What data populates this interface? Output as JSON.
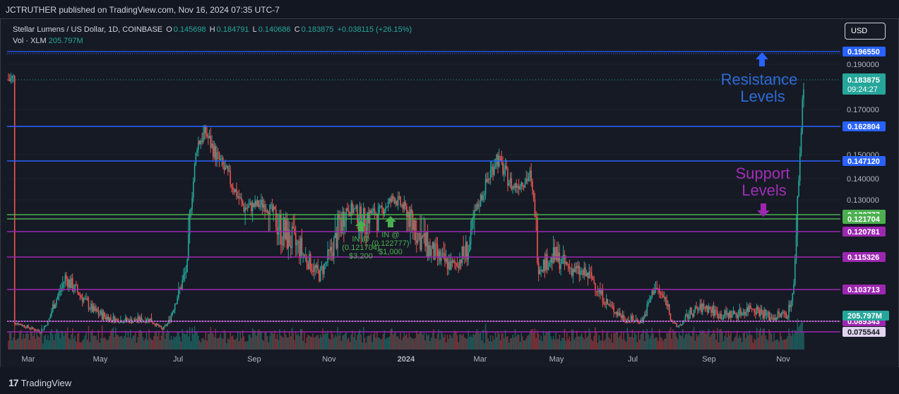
{
  "publisher_line": "JCTRUTHER published on TradingView.com, Nov 16, 2024 07:35 UTC-7",
  "header": {
    "instrument": "Stellar Lumens / US Dollar, 1D, COINBASE",
    "open_label": "O",
    "open": "0.145698",
    "high_label": "H",
    "high": "0.184791",
    "low_label": "L",
    "low": "0.140686",
    "close_label": "C",
    "close": "0.183875",
    "change": "+0.038115 (+26.15%)",
    "vol_label": "Vol · XLM",
    "vol_value": "205.797M"
  },
  "currency": "USD",
  "branding": "TradingView",
  "colors": {
    "bg": "#161a25",
    "up": "#26a69a",
    "down": "#ef5350",
    "resistance": "#2962ff",
    "support": "#9c27b0",
    "entry": "#4caf50",
    "axis_text": "#b2b5be",
    "resistance_text": "#2e6bd6",
    "support_text": "#a12eb5"
  },
  "chart_data": {
    "type": "candlestick",
    "y_ticks": [
      "0.190000",
      "0.170000",
      "0.150000",
      "0.140000",
      "0.130000"
    ],
    "x_ticks": [
      "Mar",
      "May",
      "Jul",
      "Sep",
      "Nov",
      "2024",
      "Mar",
      "May",
      "Jul",
      "Sep",
      "Nov"
    ],
    "price_labels": [
      {
        "text": "0.196550",
        "price": 0.19655,
        "color": "#2962ff"
      },
      {
        "text": "0.162804",
        "price": 0.162804,
        "color": "#2962ff"
      },
      {
        "text": "0.147120",
        "price": 0.14712,
        "color": "#2962ff"
      },
      {
        "text": "0.122777",
        "price": 0.122777,
        "color": "#4caf50"
      },
      {
        "text": "0.121704",
        "price": 0.121704,
        "color": "#4caf50"
      },
      {
        "text": "0.120781",
        "price": 0.120781,
        "color": "#9c27b0"
      },
      {
        "text": "0.115326",
        "price": 0.115326,
        "color": "#9c27b0"
      },
      {
        "text": "0.103713",
        "price": 0.103713,
        "color": "#9c27b0"
      },
      {
        "text": "0.089343",
        "price": 0.089343,
        "color": "#9c27b0"
      },
      {
        "text": "0.075544",
        "price": 0.075544,
        "color": "#e0d4ee"
      }
    ],
    "last_price": {
      "text": "0.183875",
      "countdown": "09:24:27",
      "price": 0.183875
    },
    "volume_label": "205.797M",
    "resistance_levels": [
      0.19655,
      0.162804,
      0.14712
    ],
    "support_levels": [
      0.120781,
      0.115326,
      0.103713,
      0.089343,
      0.075544
    ],
    "entry_levels": [
      0.122777,
      0.121704
    ],
    "annotations": {
      "resistance_text": [
        "Resistance",
        "Levels"
      ],
      "support_text": [
        "Support",
        "Levels"
      ],
      "entries": [
        {
          "lines": [
            "IN @",
            "(0.121704)",
            "$3,200"
          ],
          "price": 0.121704
        },
        {
          "lines": [
            "IN @",
            "(0.122777)",
            "$1,000"
          ],
          "price": 0.122777
        }
      ]
    },
    "series": [
      {
        "date": "2023-02-15",
        "close": 0.088
      },
      {
        "date": "2023-02-25",
        "close": 0.082
      },
      {
        "date": "2023-03-08",
        "close": 0.076
      },
      {
        "date": "2023-03-18",
        "close": 0.096
      },
      {
        "date": "2023-03-28",
        "close": 0.108
      },
      {
        "date": "2023-04-08",
        "close": 0.102
      },
      {
        "date": "2023-04-20",
        "close": 0.094
      },
      {
        "date": "2023-05-05",
        "close": 0.09
      },
      {
        "date": "2023-05-20",
        "close": 0.089
      },
      {
        "date": "2023-06-05",
        "close": 0.09
      },
      {
        "date": "2023-06-15",
        "close": 0.079
      },
      {
        "date": "2023-06-25",
        "close": 0.098
      },
      {
        "date": "2023-07-05",
        "close": 0.112
      },
      {
        "date": "2023-07-13",
        "close": 0.155
      },
      {
        "date": "2023-07-20",
        "close": 0.16
      },
      {
        "date": "2023-07-28",
        "close": 0.15
      },
      {
        "date": "2023-08-08",
        "close": 0.14
      },
      {
        "date": "2023-08-20",
        "close": 0.126
      },
      {
        "date": "2023-09-05",
        "close": 0.128
      },
      {
        "date": "2023-09-20",
        "close": 0.12
      },
      {
        "date": "2023-10-05",
        "close": 0.117
      },
      {
        "date": "2023-10-20",
        "close": 0.109
      },
      {
        "date": "2023-11-01",
        "close": 0.118
      },
      {
        "date": "2023-11-12",
        "close": 0.126
      },
      {
        "date": "2023-11-25",
        "close": 0.123
      },
      {
        "date": "2023-12-08",
        "close": 0.124
      },
      {
        "date": "2023-12-20",
        "close": 0.131
      },
      {
        "date": "2024-01-03",
        "close": 0.122
      },
      {
        "date": "2024-01-20",
        "close": 0.116
      },
      {
        "date": "2024-02-05",
        "close": 0.112
      },
      {
        "date": "2024-02-20",
        "close": 0.118
      },
      {
        "date": "2024-03-05",
        "close": 0.14
      },
      {
        "date": "2024-03-12",
        "close": 0.149
      },
      {
        "date": "2024-03-25",
        "close": 0.136
      },
      {
        "date": "2024-04-08",
        "close": 0.141
      },
      {
        "date": "2024-04-15",
        "close": 0.112
      },
      {
        "date": "2024-04-28",
        "close": 0.115
      },
      {
        "date": "2024-05-12",
        "close": 0.111
      },
      {
        "date": "2024-05-28",
        "close": 0.108
      },
      {
        "date": "2024-06-10",
        "close": 0.097
      },
      {
        "date": "2024-06-25",
        "close": 0.09
      },
      {
        "date": "2024-07-08",
        "close": 0.089
      },
      {
        "date": "2024-07-18",
        "close": 0.105
      },
      {
        "date": "2024-07-28",
        "close": 0.098
      },
      {
        "date": "2024-08-05",
        "close": 0.082
      },
      {
        "date": "2024-08-15",
        "close": 0.093
      },
      {
        "date": "2024-08-28",
        "close": 0.096
      },
      {
        "date": "2024-09-10",
        "close": 0.092
      },
      {
        "date": "2024-09-25",
        "close": 0.093
      },
      {
        "date": "2024-10-05",
        "close": 0.096
      },
      {
        "date": "2024-10-20",
        "close": 0.091
      },
      {
        "date": "2024-11-03",
        "close": 0.093
      },
      {
        "date": "2024-11-08",
        "close": 0.104
      },
      {
        "date": "2024-11-12",
        "close": 0.14
      },
      {
        "date": "2024-11-16",
        "close": 0.183875
      }
    ]
  }
}
